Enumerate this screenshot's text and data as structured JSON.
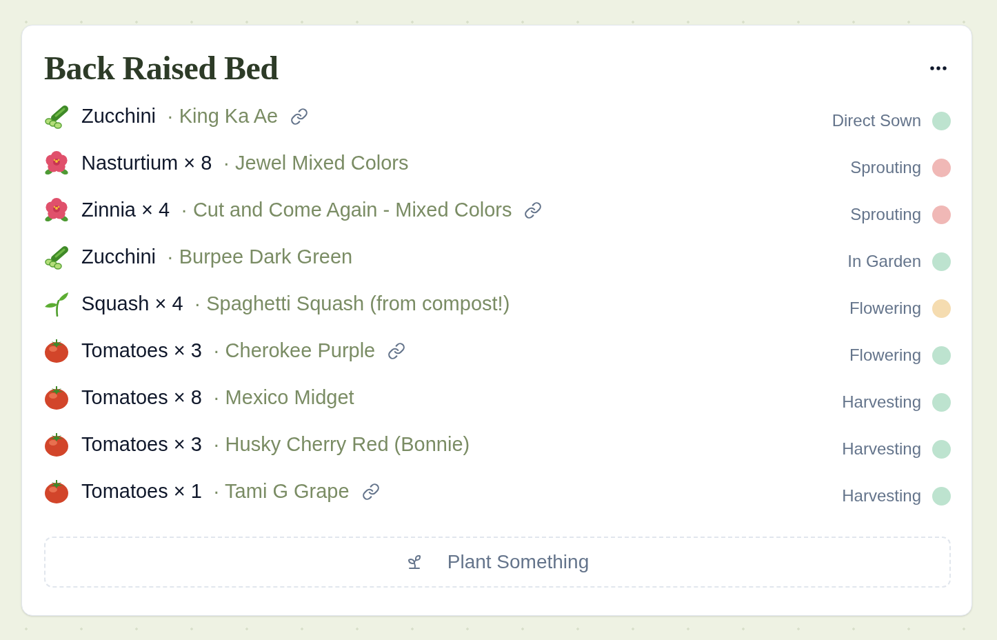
{
  "bed": {
    "title": "Back Raised Bed"
  },
  "plantings": [
    {
      "kind": "cucumber",
      "name": "Zucchini",
      "variety": "· King Ka Ae",
      "linked": true,
      "status": "Direct Sown",
      "color": "#bde3cf"
    },
    {
      "kind": "flower",
      "name": "Nasturtium × 8",
      "variety": "· Jewel Mixed Colors",
      "linked": false,
      "status": "Sprouting",
      "color": "#f0b8b6"
    },
    {
      "kind": "flower",
      "name": "Zinnia × 4",
      "variety": "· Cut and Come Again - Mixed Colors",
      "linked": true,
      "status": "Sprouting",
      "color": "#f0b8b6"
    },
    {
      "kind": "cucumber",
      "name": "Zucchini",
      "variety": "· Burpee Dark Green",
      "linked": false,
      "status": "In Garden",
      "color": "#bde3cf"
    },
    {
      "kind": "seedling",
      "name": "Squash × 4",
      "variety": "· Spaghetti Squash (from compost!)",
      "linked": false,
      "status": "Flowering",
      "color": "#f5dcb0"
    },
    {
      "kind": "tomato",
      "name": "Tomatoes × 3",
      "variety": "· Cherokee Purple",
      "linked": true,
      "status": "Flowering",
      "color": "#bde3cf"
    },
    {
      "kind": "tomato",
      "name": "Tomatoes × 8",
      "variety": "· Mexico Midget",
      "linked": false,
      "status": "Harvesting",
      "color": "#bde3cf"
    },
    {
      "kind": "tomato",
      "name": "Tomatoes × 3",
      "variety": "· Husky Cherry Red (Bonnie)",
      "linked": false,
      "status": "Harvesting",
      "color": "#bde3cf"
    },
    {
      "kind": "tomato",
      "name": "Tomatoes × 1",
      "variety": "· Tami G Grape",
      "linked": true,
      "status": "Harvesting",
      "color": "#bde3cf"
    }
  ],
  "add_button": {
    "label": "Plant Something"
  }
}
